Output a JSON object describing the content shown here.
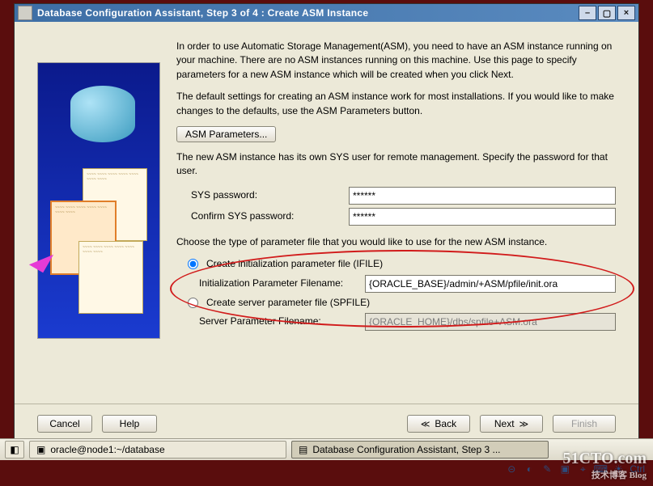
{
  "window": {
    "title": "Database Configuration Assistant, Step 3 of 4 : Create ASM Instance"
  },
  "intro": {
    "para1": "In order to use Automatic Storage Management(ASM), you need to have an ASM instance running on your machine. There are no ASM instances running on this machine. Use this page to specify parameters for a new ASM instance which will be created when you click Next.",
    "para2": "The default settings for creating an ASM instance work for most installations. If you would like to make changes to the defaults, use the ASM Parameters button.",
    "asm_params_btn": "ASM Parameters...",
    "para3": "The new ASM instance has its own SYS user for remote management. Specify the password for that user."
  },
  "passwords": {
    "sys_label": "SYS password:",
    "sys_value": "******",
    "confirm_label": "Confirm SYS password:",
    "confirm_value": "******"
  },
  "paramfile": {
    "choose_text": "Choose the type of parameter file that you would like to use for the new ASM instance.",
    "ifile_label": "Create initialization parameter file (IFILE)",
    "ifile_filename_label": "Initialization Parameter Filename:",
    "ifile_filename_value": "{ORACLE_BASE}/admin/+ASM/pfile/init.ora",
    "spfile_label": "Create server parameter file (SPFILE)",
    "spfile_filename_label": "Server Parameter Filename:",
    "spfile_filename_value": "{ORACLE_HOME}/dbs/spfile+ASM.ora"
  },
  "footer": {
    "cancel": "Cancel",
    "help": "Help",
    "back": "Back",
    "next": "Next",
    "finish": "Finish"
  },
  "taskbar": {
    "term": "oracle@node1:~/database",
    "app": "Database Configuration Assistant, Step 3 ..."
  },
  "tray": {
    "ctrl": "Ctrl"
  },
  "watermark": {
    "main": "51CTO.com",
    "sub": "技术博客  Blog"
  }
}
